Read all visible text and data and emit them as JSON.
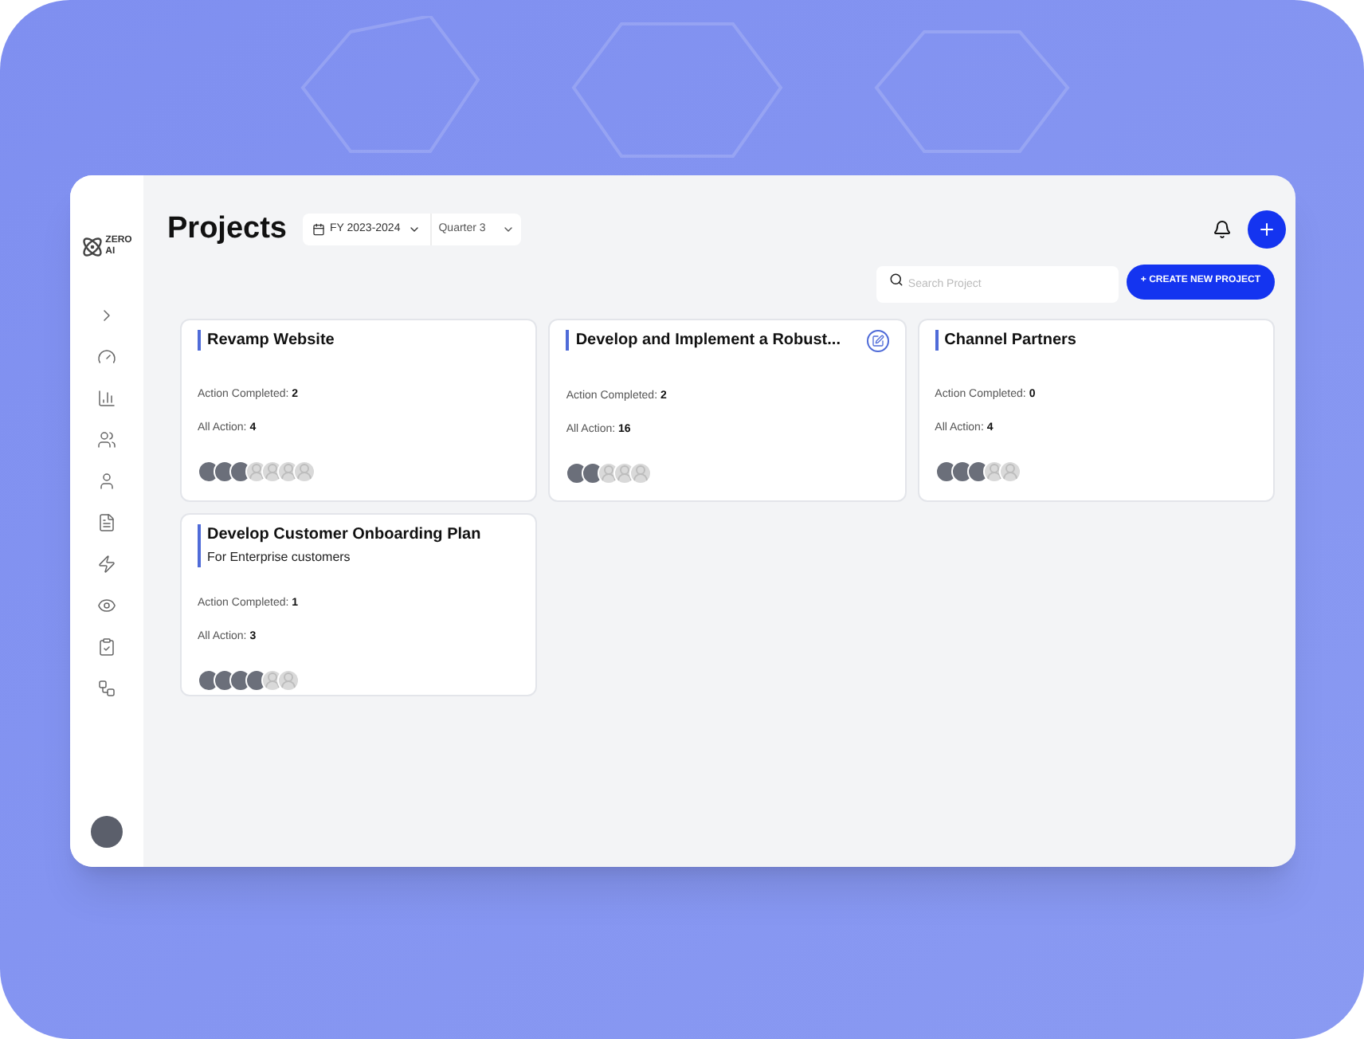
{
  "brand": {
    "line1": "ZERO",
    "line2": "AI"
  },
  "header": {
    "title": "Projects",
    "year": "FY 2023-2024",
    "quarter": "Quarter 3"
  },
  "search": {
    "placeholder": "Search Project"
  },
  "create_button": "+ CREATE NEW PROJECT",
  "cards": [
    {
      "title": "Revamp Website",
      "editable": false,
      "completed_label": "Action Completed:",
      "completed": "2",
      "all_label": "All Action:",
      "all": "4",
      "avatars": [
        {
          "kind": "photo"
        },
        {
          "kind": "photo"
        },
        {
          "kind": "photo"
        },
        {
          "kind": "placeholder"
        },
        {
          "kind": "placeholder"
        },
        {
          "kind": "placeholder"
        },
        {
          "kind": "placeholder"
        }
      ]
    },
    {
      "title": "Develop and Implement a Robust...",
      "editable": true,
      "completed_label": "Action Completed:",
      "completed": "2",
      "all_label": "All Action:",
      "all": "16",
      "avatars": [
        {
          "kind": "photo"
        },
        {
          "kind": "photo"
        },
        {
          "kind": "placeholder"
        },
        {
          "kind": "placeholder"
        },
        {
          "kind": "placeholder"
        }
      ]
    },
    {
      "title": "Channel Partners",
      "editable": false,
      "completed_label": "Action Completed:",
      "completed": "0",
      "all_label": "All Action:",
      "all": "4",
      "avatars": [
        {
          "kind": "photo"
        },
        {
          "kind": "photo"
        },
        {
          "kind": "photo"
        },
        {
          "kind": "placeholder"
        },
        {
          "kind": "placeholder"
        }
      ]
    },
    {
      "title": "Develop Customer Onboarding Plan",
      "subtitle": "For Enterprise customers",
      "editable": false,
      "completed_label": "Action Completed:",
      "completed": "1",
      "all_label": "All Action:",
      "all": "3",
      "avatars": [
        {
          "kind": "photo"
        },
        {
          "kind": "photo"
        },
        {
          "kind": "photo"
        },
        {
          "kind": "photo"
        },
        {
          "kind": "placeholder"
        },
        {
          "kind": "placeholder"
        }
      ]
    }
  ]
}
